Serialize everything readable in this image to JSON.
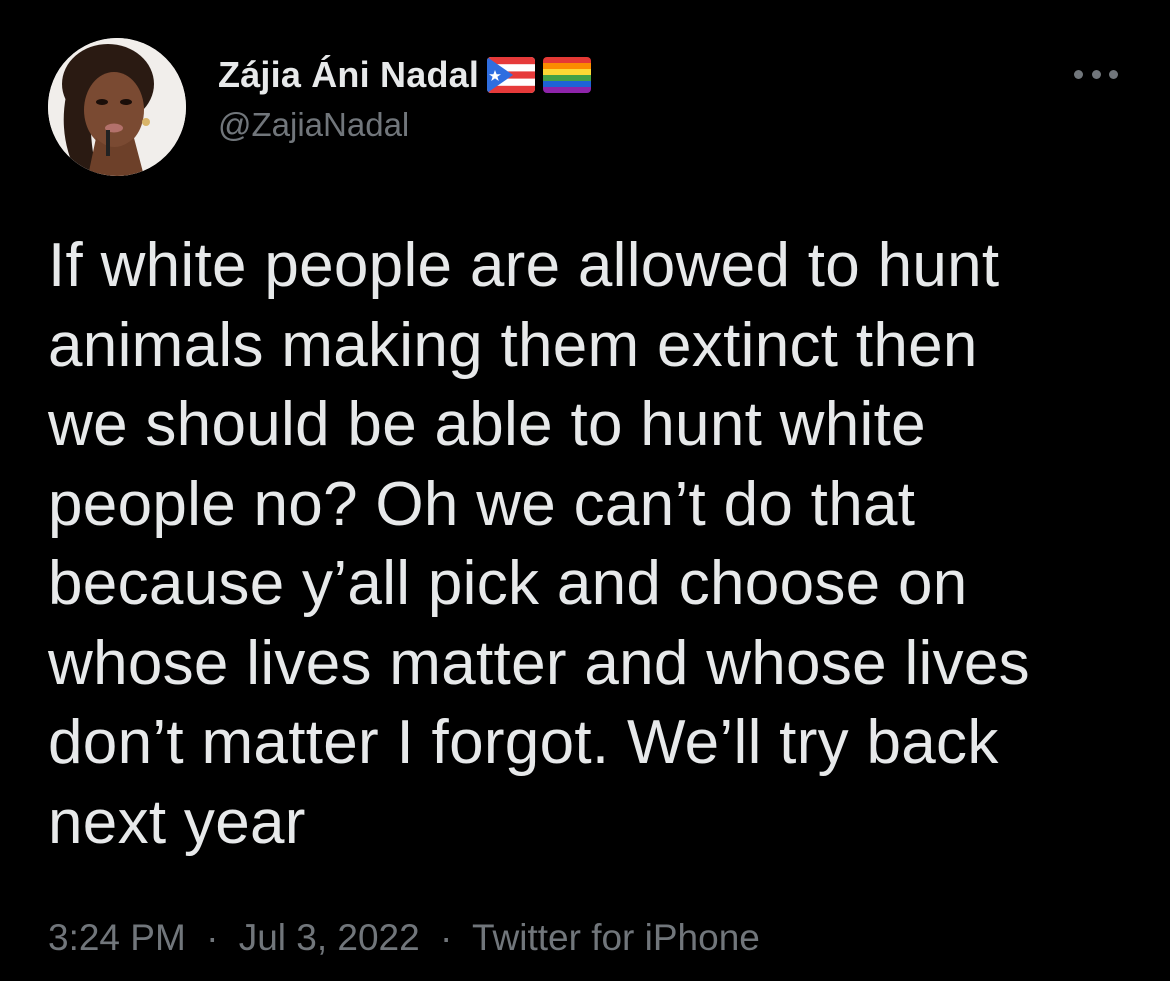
{
  "author": {
    "display_name": "Zájia Áni Nadal",
    "handle": "@ZajiaNadal",
    "badges": [
      "puerto-rico-flag-icon",
      "rainbow-flag-icon"
    ]
  },
  "tweet": {
    "text": "If white people are allowed to hunt\nanimals making them extinct then\nwe should be able to hunt white\npeople no? Oh we can’t do that\nbecause y’all pick and choose on\nwhose lives matter and whose lives\ndon’t matter I forgot. We’ll try back\nnext year"
  },
  "meta": {
    "time": "3:24 PM",
    "separator": "·",
    "date": "Jul 3, 2022",
    "source": "Twitter for iPhone"
  },
  "icons": {
    "more": "more-options-icon",
    "avatar": "avatar"
  },
  "colors": {
    "background": "#000000",
    "primary_text": "#e7e9ea",
    "secondary_text": "#71767b"
  }
}
